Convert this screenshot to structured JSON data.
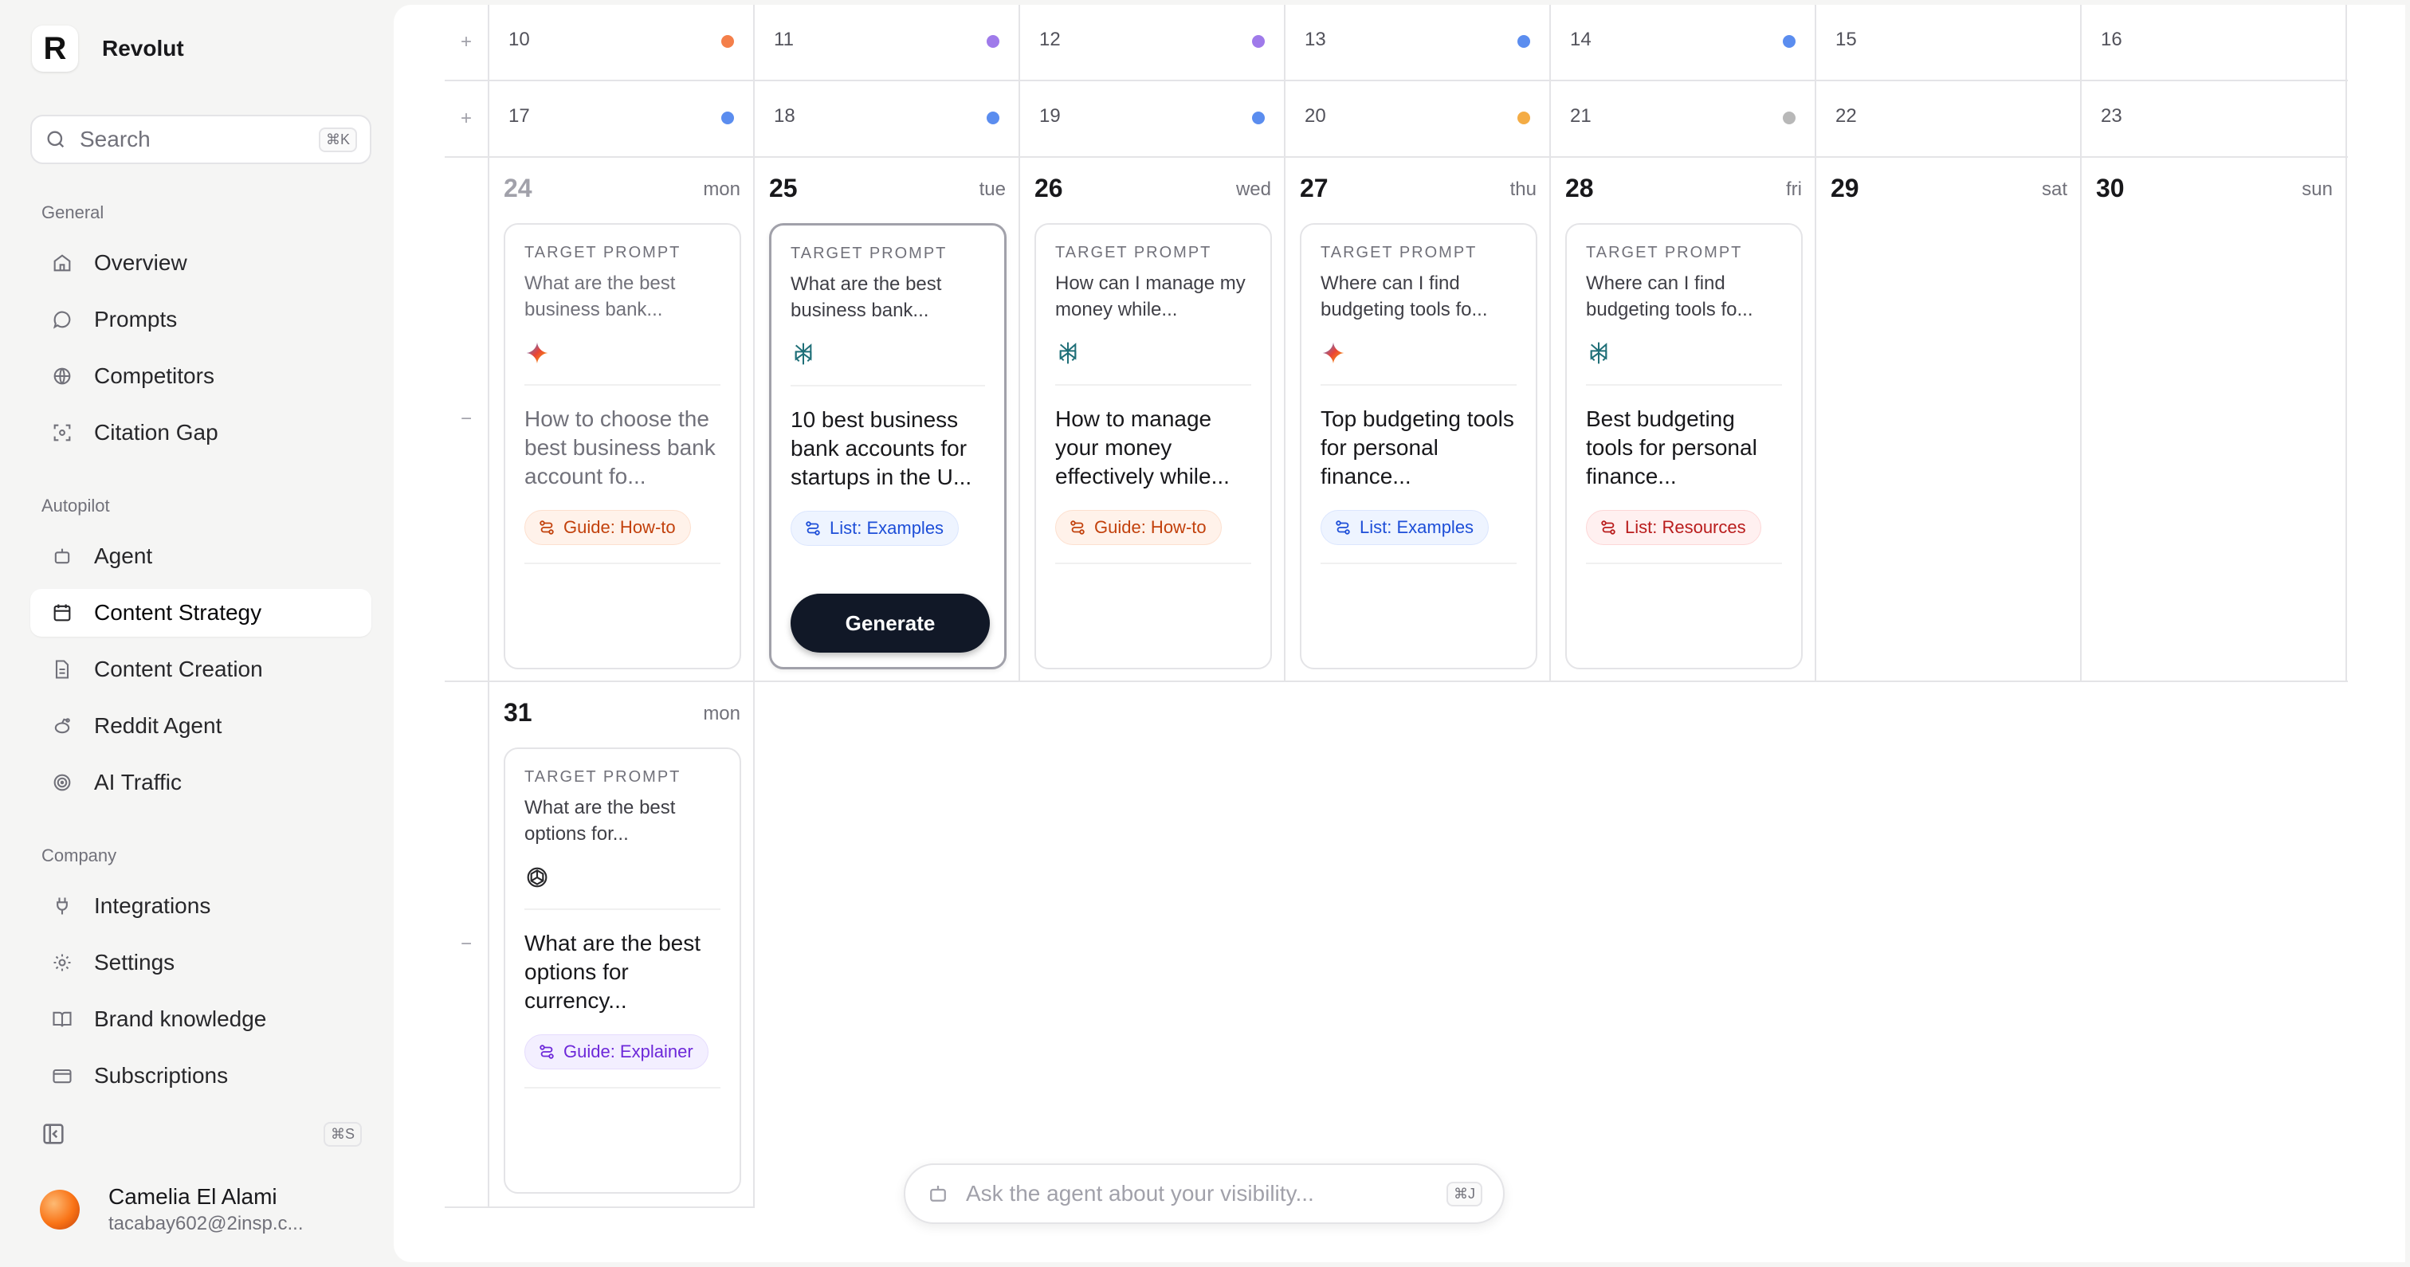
{
  "brand": {
    "logo": "R",
    "name": "Revolut"
  },
  "search": {
    "placeholder": "Search",
    "shortcut": "⌘K"
  },
  "sections": {
    "general": "General",
    "autopilot": "Autopilot",
    "company": "Company"
  },
  "nav": {
    "overview": "Overview",
    "prompts": "Prompts",
    "competitors": "Competitors",
    "citation_gap": "Citation Gap",
    "agent": "Agent",
    "content_strategy": "Content Strategy",
    "content_creation": "Content Creation",
    "reddit_agent": "Reddit Agent",
    "ai_traffic": "AI Traffic",
    "integrations": "Integrations",
    "settings": "Settings",
    "brand_knowledge": "Brand knowledge",
    "subscriptions": "Subscriptions"
  },
  "sidebar_shortcut": "⌘S",
  "user": {
    "name": "Camelia El Alami",
    "email": "tacabay602@2insp.c..."
  },
  "colors": {
    "dot_orange": "#f47f4a",
    "dot_purple": "#9f7aea",
    "dot_blue": "#5b8def",
    "dot_amber": "#f4ac45",
    "dot_gray": "#b8b8b8",
    "generate_bg": "#111827"
  },
  "calendar": {
    "week_toggles": {
      "w1": "+",
      "w2": "+",
      "w3": "−",
      "w4": "−"
    },
    "week1": {
      "d1": "10",
      "d2": "11",
      "d3": "12",
      "d4": "13",
      "d5": "14",
      "d6": "15",
      "d7": "16"
    },
    "week2": {
      "d1": "17",
      "d2": "18",
      "d3": "19",
      "d4": "20",
      "d5": "21",
      "d6": "22",
      "d7": "23"
    },
    "week3": [
      {
        "num": "24",
        "name": "mon"
      },
      {
        "num": "25",
        "name": "tue"
      },
      {
        "num": "26",
        "name": "wed"
      },
      {
        "num": "27",
        "name": "thu"
      },
      {
        "num": "28",
        "name": "fri"
      },
      {
        "num": "29",
        "name": "sat"
      },
      {
        "num": "30",
        "name": "sun"
      }
    ],
    "week4": [
      {
        "num": "31",
        "name": "mon"
      }
    ]
  },
  "cards": [
    {
      "label": "TARGET PROMPT",
      "prompt": "What are the best business bank...",
      "model": "gemini-icon",
      "title": "How to choose the best business bank account fo...",
      "tag": "Guide: How-to"
    },
    {
      "label": "TARGET PROMPT",
      "prompt": "What are the best business bank...",
      "model": "perplexity-icon",
      "title": "10 best business bank accounts for startups in the U...",
      "tag": "List: Examples",
      "action": "Generate"
    },
    {
      "label": "TARGET PROMPT",
      "prompt": "How can I manage my money while...",
      "model": "perplexity-icon",
      "title": "How to manage your money effectively while...",
      "tag": "Guide: How-to"
    },
    {
      "label": "TARGET PROMPT",
      "prompt": "Where can I find budgeting tools fo...",
      "model": "gemini-icon",
      "title": "Top budgeting tools for personal finance...",
      "tag": "List: Examples"
    },
    {
      "label": "TARGET PROMPT",
      "prompt": "Where can I find budgeting tools fo...",
      "model": "perplexity-icon",
      "title": "Best budgeting tools for personal finance...",
      "tag": "List: Resources"
    },
    {
      "label": "TARGET PROMPT",
      "prompt": "What are the best options for...",
      "model": "openai-icon",
      "title": "What are the best options for currency...",
      "tag": "Guide: Explainer"
    }
  ],
  "ask": {
    "placeholder": "Ask the agent about your visibility...",
    "shortcut": "⌘J"
  }
}
